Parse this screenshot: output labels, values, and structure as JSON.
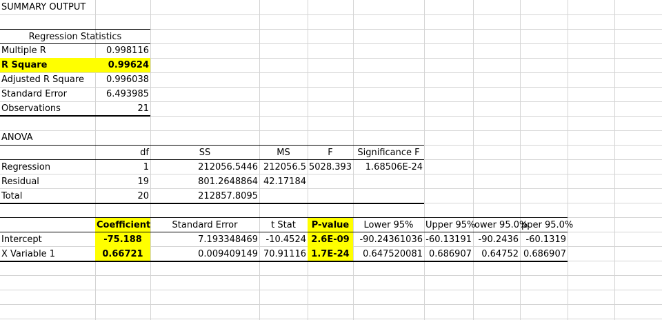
{
  "sheet": {
    "title": "SUMMARY OUTPUT",
    "regression_statistics": {
      "header": "Regression Statistics",
      "rows": [
        {
          "label": "Multiple R",
          "value": "0.998116"
        },
        {
          "label": "R Square",
          "value": "0.99624"
        },
        {
          "label": "Adjusted R Square",
          "value": "0.996038"
        },
        {
          "label": "Standard Error",
          "value": "6.493985"
        },
        {
          "label": "Observations",
          "value": "21"
        }
      ]
    },
    "anova": {
      "title": "ANOVA",
      "headers": [
        "df",
        "SS",
        "MS",
        "F",
        "Significance F"
      ],
      "rows": [
        {
          "label": "Regression",
          "df": "1",
          "ss": "212056.5446",
          "ms": "212056.5",
          "f": "5028.393",
          "sig_f": "1.68506E-24"
        },
        {
          "label": "Residual",
          "df": "19",
          "ss": "801.2648864",
          "ms": "42.17184",
          "f": "",
          "sig_f": ""
        },
        {
          "label": "Total",
          "df": "20",
          "ss": "212857.8095",
          "ms": "",
          "f": "",
          "sig_f": ""
        }
      ]
    },
    "coefficients": {
      "headers": [
        "Coefficient",
        "Standard Error",
        "t Stat",
        "P-value",
        "Lower 95%",
        "Upper 95%",
        "ower 95.0%",
        "pper 95.0%"
      ],
      "rows": [
        {
          "label": "Intercept",
          "coef": "-75.188",
          "se": "7.193348469",
          "t": "-10.4524",
          "p": "2.6E-09",
          "lower95": "-90.24361036",
          "upper95": "-60.13191",
          "lower950": "-90.2436",
          "upper950": "-60.1319"
        },
        {
          "label": "X Variable 1",
          "coef": "0.66721",
          "se": "0.009409149",
          "t": "70.91116",
          "p": "1.7E-24",
          "lower95": "0.647520081",
          "upper95": "0.686907",
          "lower950": "0.64752",
          "upper950": "0.686907"
        }
      ]
    }
  },
  "colors": {
    "highlight": "#ffff00",
    "gridline": "#d4d4d4",
    "rule": "#000000"
  }
}
